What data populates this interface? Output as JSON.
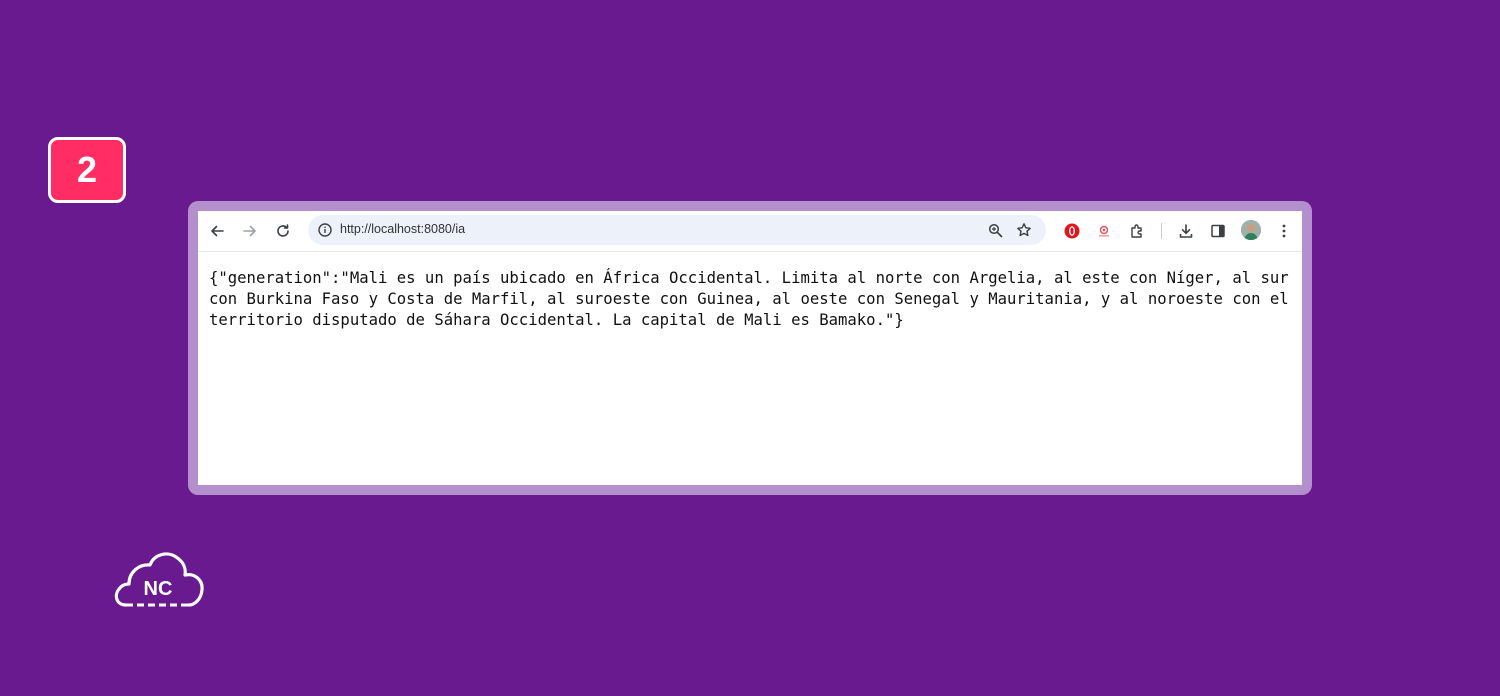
{
  "step": {
    "number": "2"
  },
  "browser": {
    "url": "http://localhost:8080/ia",
    "toolbar": {
      "back_icon": "arrow-left-icon",
      "forward_icon": "arrow-right-icon",
      "reload_icon": "reload-icon",
      "site_info_icon": "info-circle-icon",
      "zoom_icon": "zoom-icon",
      "bookmark_icon": "star-icon",
      "extensions": [
        "opera-icon",
        "red-extension-icon",
        "puzzle-extensions-icon"
      ],
      "download_icon": "download-icon",
      "side_panel_icon": "side-panel-icon",
      "menu_icon": "kebab-menu-icon"
    },
    "page_content": "{\"generation\":\"Mali es un país ubicado en África Occidental. Limita al norte con Argelia, al este con Níger, al sur con Burkina Faso y Costa de Marfil, al suroeste con Guinea, al oeste con Senegal y Mauritania, y al noroeste con el territorio disputado de Sáhara Occidental. La capital de Mali es Bamako.\"}"
  },
  "logo": {
    "text": "NC"
  },
  "colors": {
    "background": "#681a8e",
    "badge": "#ff2d63",
    "frame": "#b48fce",
    "omnibox": "#edf2fa"
  }
}
